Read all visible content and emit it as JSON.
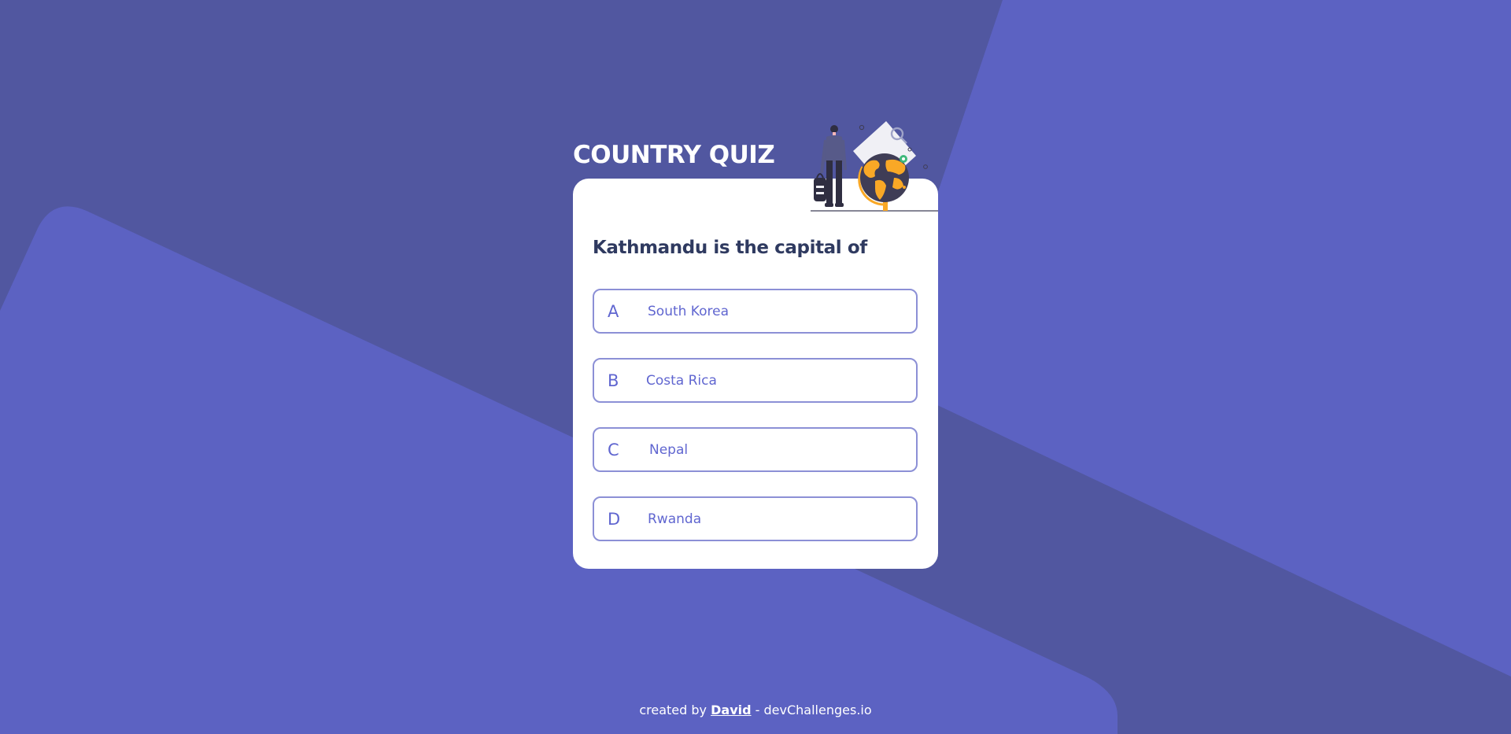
{
  "quiz": {
    "title": "COUNTRY QUIZ",
    "question": "Kathmandu is the capital of",
    "options": [
      {
        "letter": "A",
        "text": "South Korea"
      },
      {
        "letter": "B",
        "text": "Costa Rica"
      },
      {
        "letter": "C",
        "text": "Nepal"
      },
      {
        "letter": "D",
        "text": "Rwanda"
      }
    ]
  },
  "footer": {
    "prefix": "created by",
    "author": "David",
    "suffix": "- devChallenges.io"
  },
  "colors": {
    "background": "#5157a0",
    "background_shape": "#5c62c2",
    "title_text": "#ffffff",
    "card": "#ffffff",
    "question_text": "#2f3a60",
    "option_accent": "#6066d0",
    "option_border": "#8c90d6",
    "globe_land": "#f9a826"
  },
  "icons": {
    "illustration": "traveler-with-globe-illustration"
  }
}
